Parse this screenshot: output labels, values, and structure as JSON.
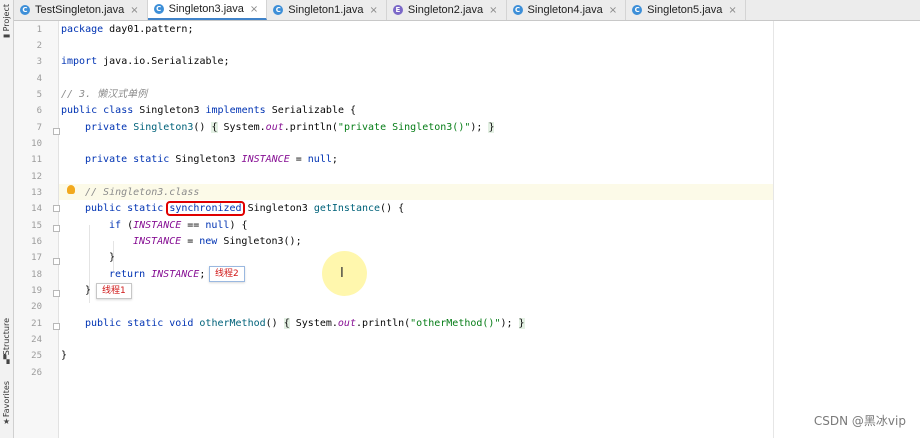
{
  "tabs": [
    {
      "label": "TestSingleton.java",
      "icon": "class-icon",
      "active": false
    },
    {
      "label": "Singleton3.java",
      "icon": "class-icon",
      "active": true
    },
    {
      "label": "Singleton1.java",
      "icon": "class-icon",
      "active": false
    },
    {
      "label": "Singleton2.java",
      "icon": "enum-icon",
      "active": false
    },
    {
      "label": "Singleton4.java",
      "icon": "class-icon",
      "active": false
    },
    {
      "label": "Singleton5.java",
      "icon": "class-icon",
      "active": false
    }
  ],
  "sidebar": {
    "project": "Project",
    "structure": "Structure",
    "favorites": "Favorites"
  },
  "line_numbers": [
    "1",
    "2",
    "3",
    "4",
    "5",
    "6",
    "7",
    "10",
    "11",
    "12",
    "13",
    "14",
    "15",
    "16",
    "17",
    "18",
    "19",
    "20",
    "21",
    "24",
    "25",
    "26"
  ],
  "code": {
    "l1_kw": "package",
    "l1_rest": " day01.pattern;",
    "l3_kw": "import",
    "l3_rest": " java.io.Serializable;",
    "l5_comment": "// 3. 懒汉式单例",
    "l6_kw1": "public class",
    "l6_name": " Singleton3 ",
    "l6_kw2": "implements",
    "l6_rest": " Serializable {",
    "l7_kw": "private",
    "l7_fn": "Singleton3",
    "l7_paren": "() ",
    "l7_ob": "{",
    "l7_call_a": " System.",
    "l7_out": "out",
    "l7_call_b": ".println(",
    "l7_str": "\"private Singleton3()\"",
    "l7_end": "); ",
    "l7_cb": "}",
    "l11_kw": "private static",
    "l11_type": " Singleton3 ",
    "l11_const": "INSTANCE",
    "l11_eq": " = ",
    "l11_null": "null",
    "l11_semi": ";",
    "l13_comment": "// Singleton3.class",
    "l14_kw": "public static",
    "l14_sync": "synchronized",
    "l14_type": " Singleton3 ",
    "l14_fn": "getInstance",
    "l14_rest": "() {",
    "l15_kw": "if",
    "l15_a": " (",
    "l15_const": "INSTANCE",
    "l15_b": " == ",
    "l15_null": "null",
    "l15_c": ") {",
    "l16_const": "INSTANCE",
    "l16_a": " = ",
    "l16_new": "new",
    "l16_rest": " Singleton3();",
    "l17": "}",
    "l18_kw": "return",
    "l18_const": " INSTANCE",
    "l18_semi": ";",
    "l19": "}",
    "l21_kw": "public static void",
    "l21_fn": "otherMethod",
    "l21_paren": "() ",
    "l21_ob": "{",
    "l21_call_a": " System.",
    "l21_out": "out",
    "l21_call_b": ".println(",
    "l21_str": "\"otherMethod()\"",
    "l21_end": "); ",
    "l21_cb": "}",
    "l25": "}"
  },
  "annotations": {
    "thread1": "线程1",
    "thread2": "线程2"
  },
  "watermark": "CSDN @黑冰vip",
  "colors": {
    "keyword": "#0033b3",
    "string": "#067d17",
    "method": "#00627a",
    "constant": "#871094",
    "comment": "#8c8c8c",
    "highlight_box": "#e00000"
  }
}
